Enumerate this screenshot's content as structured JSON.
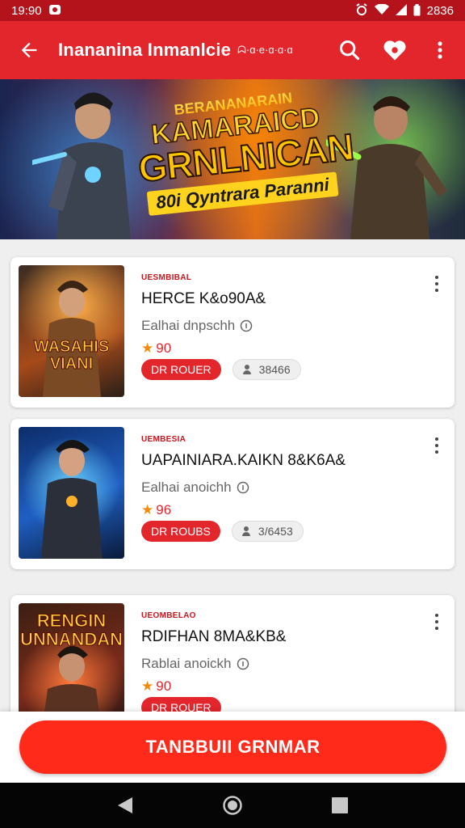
{
  "status_bar": {
    "time": "19:90",
    "battery": "2836"
  },
  "app_bar": {
    "title": "Inananina Inmanlcie",
    "subtitle": "ᗣ·ɑ·e·ɑ·ɑ·ɑ",
    "back_icon": "arrow-back-icon",
    "search_icon": "search-icon",
    "favorite_icon": "heart-icon",
    "more_icon": "more-vert-icon"
  },
  "banner": {
    "line1": "BERANANARAIN",
    "line2": "KAMARAICD",
    "line3": "GRNLNICAN",
    "line4": "80i Qyntrara Paranni"
  },
  "cards": [
    {
      "category": "UESMBIBAL",
      "title": "HERCE K&o90A&",
      "subtitle": "Ealhai dnpschh",
      "rating": "90",
      "chip_red": "DR ROUER",
      "chip_grey": "38466",
      "thumb_text": "WASAHIS VIANI"
    },
    {
      "category": "UEMBESIA",
      "title": "UAPAINIARA.KAIKN 8&K6A&",
      "subtitle": "Ealhai anoichh",
      "rating": "96",
      "chip_red": "DR ROUBS",
      "chip_grey": "3/6453",
      "thumb_text": ""
    },
    {
      "category": "UEOMBELAO",
      "title": "RDIFHAN 8MA&KB&",
      "subtitle": "Rablai anoickh",
      "rating": "90",
      "chip_red": "DR ROUER",
      "chip_grey": "",
      "thumb_text": "RENGIN UNNANDAN"
    }
  ],
  "cta": {
    "label": "TANBBUII GRNMAR"
  },
  "colors": {
    "primary": "#e3262c",
    "status_bar": "#b4131b",
    "cta": "#ff2a1a",
    "star": "#f08a0c"
  }
}
